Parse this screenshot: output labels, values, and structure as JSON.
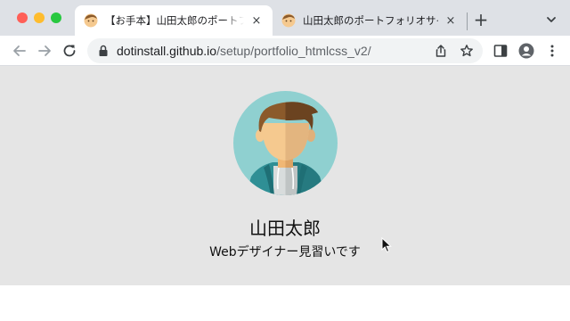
{
  "window": {
    "traffic_lights": {
      "close": "#ff5f57",
      "minimize": "#febc2e",
      "zoom": "#28c840"
    }
  },
  "tabs": [
    {
      "title": "【お手本】山田太郎のポートフォリオサイト",
      "close": "×",
      "active": true,
      "favicon": "avatar-favicon"
    },
    {
      "title": "山田太郎のポートフォリオサイト",
      "close": "×",
      "active": false,
      "favicon": "avatar-favicon"
    }
  ],
  "new_tab": "+",
  "toolbar": {
    "url_host": "dotinstall.github.io",
    "url_path": "/setup/portfolio_htmlcss_v2/",
    "icons": [
      "back-icon",
      "forward-icon",
      "reload-icon",
      "lock-icon",
      "share-icon",
      "bookmark-star-icon",
      "side-panel-icon",
      "profile-icon",
      "kebab-menu-icon"
    ]
  },
  "page": {
    "name": "山田太郎",
    "role": "Webデザイナー見習いです",
    "background": "#e5e5e5",
    "avatar_colors": {
      "circle": "#8fd0d0",
      "skin": "#f5c98f",
      "hair": "#8b5a2b",
      "hoodie": "#2f8f95"
    }
  }
}
